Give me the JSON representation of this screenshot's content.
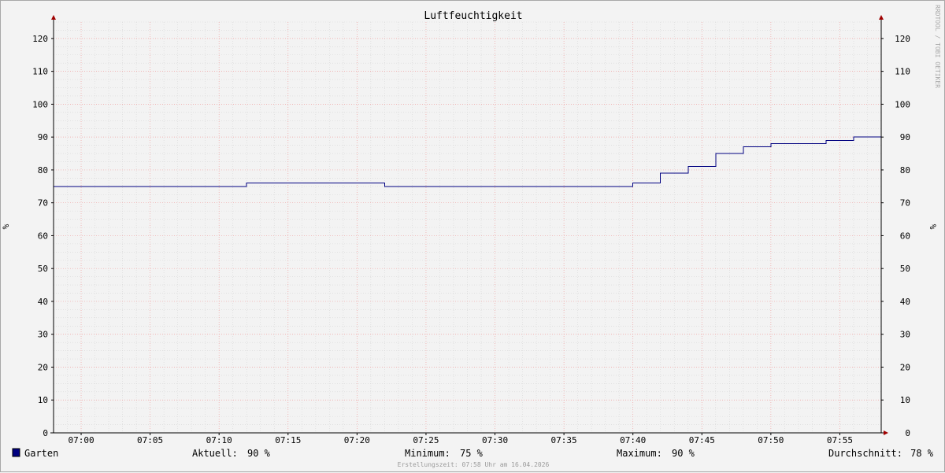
{
  "chart_data": {
    "type": "line",
    "title": "Luftfeuchtigkeit",
    "ylabel": "%",
    "ylabel_right": "%",
    "ylim": [
      0,
      125
    ],
    "yticks": [
      0,
      10,
      20,
      30,
      40,
      50,
      60,
      70,
      80,
      90,
      100,
      110,
      120
    ],
    "xlim_minutes": [
      418,
      478
    ],
    "xticks": [
      "07:00",
      "07:05",
      "07:10",
      "07:15",
      "07:20",
      "07:25",
      "07:30",
      "07:35",
      "07:40",
      "07:45",
      "07:50",
      "07:55"
    ],
    "grid": true,
    "watermark": "RRDTOOL / TOBI OETIKER",
    "series": [
      {
        "name": "Garten",
        "color": "#000080",
        "points": [
          [
            "06:58",
            75
          ],
          [
            "07:12",
            76
          ],
          [
            "07:22",
            75
          ],
          [
            "07:40",
            76
          ],
          [
            "07:42",
            79
          ],
          [
            "07:44",
            81
          ],
          [
            "07:46",
            85
          ],
          [
            "07:48",
            87
          ],
          [
            "07:50",
            88
          ],
          [
            "07:54",
            89
          ],
          [
            "07:56",
            90
          ],
          [
            "07:58",
            90
          ]
        ]
      }
    ],
    "legend": {
      "series_name": "Garten",
      "current_label": "Aktuell:",
      "current_value": "90 %",
      "min_label": "Minimum:",
      "min_value": "75 %",
      "max_label": "Maximum:",
      "max_value": "90 %",
      "avg_label": "Durchschnitt:",
      "avg_value": "78 %"
    },
    "footer": "Erstellungszeit: 07:58 Uhr am 16.04.2026"
  }
}
